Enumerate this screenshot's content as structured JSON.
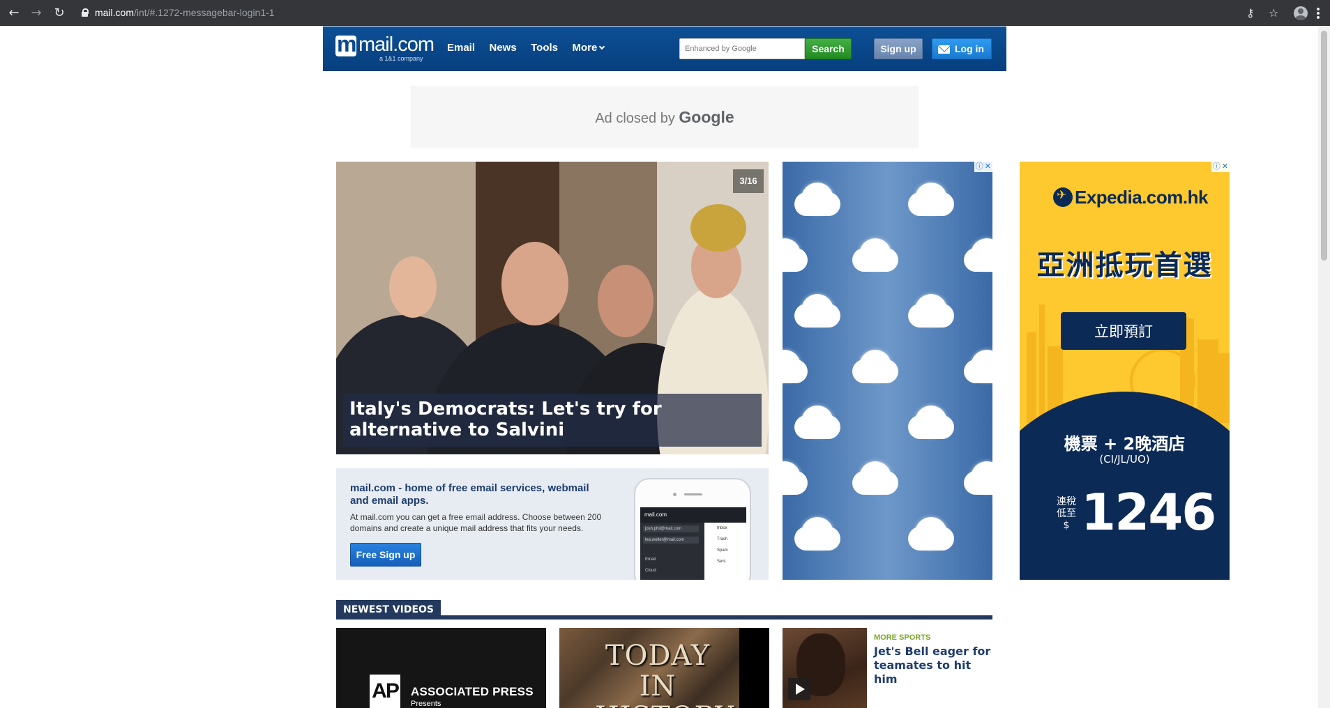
{
  "browser": {
    "url_domain": "mail.com",
    "url_path": "/int/#.1272-messagebar-login1-1"
  },
  "header": {
    "logo_word": "mail.com",
    "logo_sub": "a 1&1 company",
    "nav": [
      "Email",
      "News",
      "Tools",
      "More"
    ],
    "search_placeholder": "Enhanced by Google",
    "search_label": "Search",
    "signup_label": "Sign up",
    "login_label": "Log in"
  },
  "ad_closed": {
    "text": "Ad closed by",
    "brand": "Google"
  },
  "hero": {
    "counter": "3/16",
    "headline": "Italy's Democrats: Let's try for alternative to Salvini"
  },
  "promo": {
    "title": "mail.com - home of free email services, webmail and email apps.",
    "body": "At mail.com you can get a free email address. Choose between 200 domains and create a unique mail address that fits your needs.",
    "button": "Free Sign up",
    "phone": {
      "app_title": "mail.com",
      "rows": [
        "josh.phil@mail.com",
        "lea.wolter@mail.com",
        "Email",
        "Cloud"
      ],
      "folders": [
        "Inbox",
        "Trash",
        "Spam",
        "Sent"
      ]
    }
  },
  "expedia_ad": {
    "brand": "Expedia.com.hk",
    "headline": "亞洲抵玩首選",
    "button": "立即預訂",
    "line1": "機票 + 2晚酒店",
    "line2": "(CI/JL/UO)",
    "tax_note": "連稅低至$",
    "price": "1246"
  },
  "videos": {
    "section_title": "NEWEST VIDEOS",
    "ap": {
      "logo": "AP",
      "name": "ASSOCIATED PRESS",
      "sub": "Presents"
    },
    "history": {
      "title": "TODAY IN HISTORY"
    },
    "sport": {
      "kicker": "MORE SPORTS",
      "headline": "Jet's Bell eager for teamates to hit him"
    }
  },
  "colors": {
    "header_blue": "#0a4a8c",
    "search_green": "#2e9b2e",
    "expedia_yellow": "#fec82f",
    "expedia_navy": "#0b2a56"
  }
}
